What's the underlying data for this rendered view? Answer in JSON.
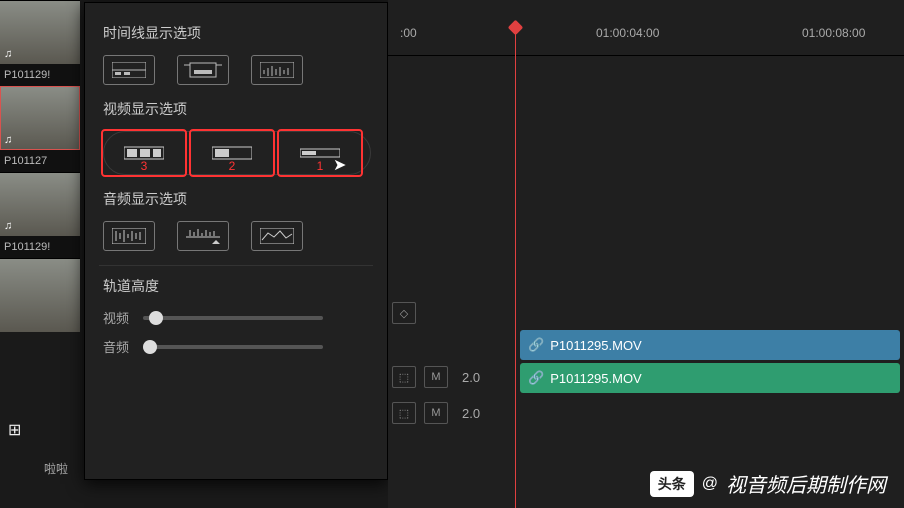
{
  "media": {
    "items": [
      {
        "label": "P101129!"
      },
      {
        "label": "P101127"
      },
      {
        "label": "P101129!"
      }
    ],
    "audio_icon": "♫",
    "bottom_label": "啦啦"
  },
  "popup": {
    "timeline_heading": "时间线显示选项",
    "video_heading": "视频显示选项",
    "audio_heading": "音频显示选项",
    "track_heading": "轨道高度",
    "video_label": "视频",
    "audio_label": "音频",
    "nums": {
      "a": "3",
      "b": "2",
      "c": "1"
    }
  },
  "timeline": {
    "t0": ":00",
    "t1": "01:00:04:00",
    "t2": "01:00:08:00",
    "tracks": [
      {
        "mute": "M",
        "scale": "2.0"
      },
      {
        "mute": "M",
        "scale": "2.0"
      }
    ],
    "clips": [
      {
        "name": "P1011295.MOV"
      },
      {
        "name": "P1011295.MOV"
      }
    ],
    "link_glyph": "🔗"
  },
  "watermark": {
    "badge": "头条",
    "at": "@",
    "text": "视音频后期制作网"
  }
}
